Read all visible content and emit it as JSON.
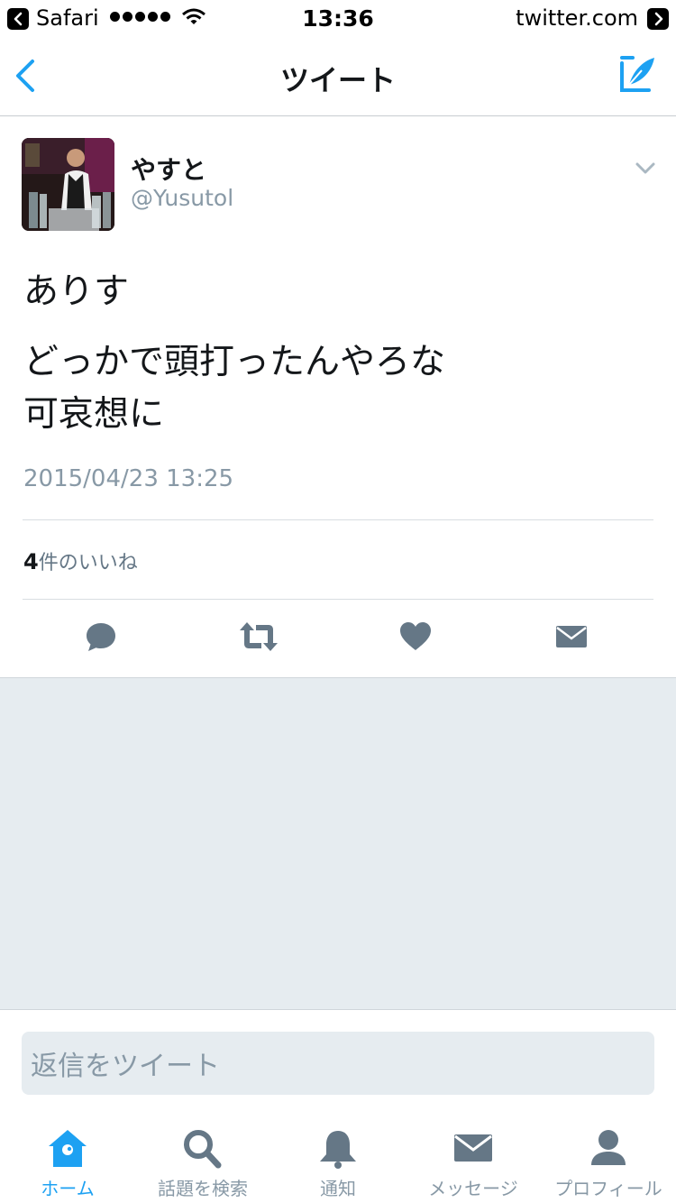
{
  "status_bar": {
    "app_name": "Safari",
    "time": "13:36",
    "host": "twitter.com"
  },
  "nav": {
    "title": "ツイート"
  },
  "tweet": {
    "author_name": "やすと",
    "author_handle": "@Yusutol",
    "text_lines": [
      "ありす",
      "どっかで頭打ったんやろな",
      "可哀想に"
    ],
    "timestamp": "2015/04/23 13:25",
    "like_count": "4",
    "like_suffix": "件のいいね"
  },
  "reply": {
    "placeholder": "返信をツイート"
  },
  "tab_bar": {
    "tabs": [
      {
        "label": "ホーム",
        "icon": "home-icon",
        "active": true
      },
      {
        "label": "話題を検索",
        "icon": "search-icon",
        "active": false
      },
      {
        "label": "通知",
        "icon": "bell-icon",
        "active": false
      },
      {
        "label": "メッセージ",
        "icon": "envelope-icon",
        "active": false
      },
      {
        "label": "プロフィール",
        "icon": "person-icon",
        "active": false
      }
    ]
  },
  "colors": {
    "accent": "#1da1f2",
    "icon_gray": "#657786",
    "secondary_text": "#8899a6",
    "background_gray": "#e6ecf0"
  }
}
